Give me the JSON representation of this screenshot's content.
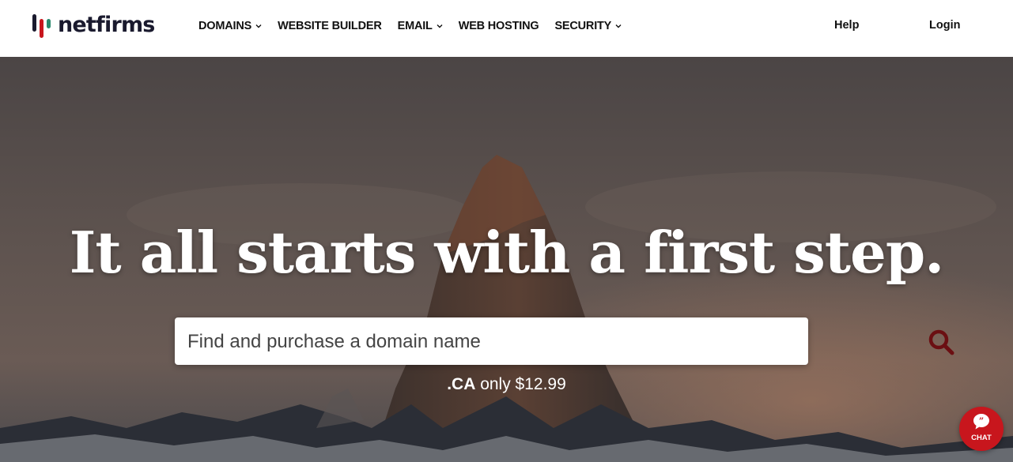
{
  "brand": {
    "name": "netfirms",
    "logo_colors": [
      "#c8161d",
      "#1a1a2e",
      "#2a8a6e"
    ]
  },
  "nav": {
    "items": [
      {
        "label": "DOMAINS",
        "has_dropdown": true
      },
      {
        "label": "WEBSITE BUILDER",
        "has_dropdown": false
      },
      {
        "label": "EMAIL",
        "has_dropdown": true
      },
      {
        "label": "WEB HOSTING",
        "has_dropdown": false
      },
      {
        "label": "SECURITY",
        "has_dropdown": true
      }
    ],
    "help": "Help",
    "login": "Login"
  },
  "hero": {
    "headline": "It all starts with a first step.",
    "search": {
      "placeholder": "Find and purchase a domain name",
      "value": "",
      "icon": "search-icon",
      "icon_color": "#6b0f12"
    },
    "promo": {
      "tld": ".CA",
      "text": "only $12.99"
    }
  },
  "chat": {
    "label": "CHAT",
    "icon": "chat-quote-icon",
    "color": "#c8161d"
  }
}
